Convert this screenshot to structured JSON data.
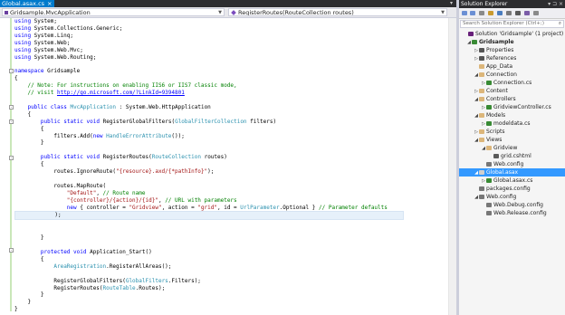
{
  "window": {
    "tab": "Global.asax.cs",
    "tab_close": "×",
    "tab_overflow": "▾"
  },
  "nav": {
    "left_scope": "Gridsample.MvcApplication",
    "right_member": "RegisterRoutes(RouteCollection routes)"
  },
  "code_lines": [
    "using System;",
    "using System.Collections.Generic;",
    "using System.Linq;",
    "using System.Web;",
    "using System.Web.Mvc;",
    "using System.Web.Routing;",
    "",
    "namespace Gridsample",
    "{",
    "    // Note: For instructions on enabling IIS6 or IIS7 classic mode,",
    "    // visit http://go.microsoft.com/?LinkId=9394801",
    "",
    "    public class MvcApplication : System.Web.HttpApplication",
    "    {",
    "        public static void RegisterGlobalFilters(GlobalFilterCollection filters)",
    "        {",
    "            filters.Add(new HandleErrorAttribute());",
    "        }",
    "",
    "        public static void RegisterRoutes(RouteCollection routes)",
    "        {",
    "            routes.IgnoreRoute(\"{resource}.axd/{*pathInfo}\");",
    "",
    "            routes.MapRoute(",
    "                \"Default\", // Route name",
    "                \"{controller}/{action}/{id}\", // URL with parameters",
    "                new { controller = \"Gridview\", action = \"grid\", id = UrlParameter.Optional } // Parameter defaults",
    "            );",
    "",
    "",
    "        }",
    "",
    "        protected void Application_Start()",
    "        {",
    "            AreaRegistration.RegisterAllAreas();",
    "",
    "            RegisterGlobalFilters(GlobalFilters.Filters);",
    "            RegisterRoutes(RouteTable.Routes);",
    "        }",
    "    }",
    "}"
  ],
  "solution_explorer": {
    "title": "Solution Explorer",
    "title_controls": "▾ ⊐ ×",
    "search_placeholder": "Search Solution Explorer (Ctrl+;)",
    "search_icon": "⌕",
    "items": [
      {
        "label": "Solution 'Gridsample' (1 project)",
        "icon": "solution-icon",
        "color": "#68217a"
      },
      {
        "label": "Gridsample",
        "icon": "csharp-project-icon",
        "color": "#388a34",
        "bold": true,
        "arrow": "◢"
      },
      {
        "label": "Properties",
        "icon": "wrench-icon",
        "color": "#555555",
        "arrow": "▷"
      },
      {
        "label": "References",
        "icon": "references-icon",
        "color": "#555555",
        "arrow": "▷"
      },
      {
        "label": "App_Data",
        "icon": "folder-icon",
        "color": "#dcb67a"
      },
      {
        "label": "Connection",
        "icon": "folder-icon",
        "color": "#dcb67a",
        "arrow": "◢"
      },
      {
        "label": "Connection.cs",
        "icon": "csharp-file-icon",
        "color": "#388a34",
        "arrow": "▷"
      },
      {
        "label": "Content",
        "icon": "folder-icon",
        "color": "#dcb67a",
        "arrow": "▷"
      },
      {
        "label": "Controllers",
        "icon": "folder-icon",
        "color": "#dcb67a",
        "arrow": "◢"
      },
      {
        "label": "GridviewController.cs",
        "icon": "csharp-file-icon",
        "color": "#388a34",
        "arrow": "▷"
      },
      {
        "label": "Models",
        "icon": "folder-icon",
        "color": "#dcb67a",
        "arrow": "◢"
      },
      {
        "label": "modeldata.cs",
        "icon": "csharp-file-icon",
        "color": "#388a34",
        "arrow": "▷"
      },
      {
        "label": "Scripts",
        "icon": "folder-icon",
        "color": "#dcb67a",
        "arrow": "▷"
      },
      {
        "label": "Views",
        "icon": "folder-icon",
        "color": "#dcb67a",
        "arrow": "◢"
      },
      {
        "label": "Gridview",
        "icon": "folder-icon",
        "color": "#dcb67a",
        "arrow": "◢"
      },
      {
        "label": "grid.cshtml",
        "icon": "razor-file-icon",
        "color": "#5a5a5a"
      },
      {
        "label": "Web.config",
        "icon": "config-file-icon",
        "color": "#777777"
      },
      {
        "label": "Global.asax",
        "icon": "asax-file-icon",
        "color": "#cfcfcf",
        "arrow": "◢",
        "selected": true
      },
      {
        "label": "Global.asax.cs",
        "icon": "csharp-file-icon",
        "color": "#388a34",
        "arrow": "▷"
      },
      {
        "label": "packages.config",
        "icon": "config-file-icon",
        "color": "#777777"
      },
      {
        "label": "Web.config",
        "icon": "config-file-icon",
        "color": "#777777",
        "arrow": "◢"
      },
      {
        "label": "Web.Debug.config",
        "icon": "config-file-icon",
        "color": "#777777"
      },
      {
        "label": "Web.Release.config",
        "icon": "config-file-icon",
        "color": "#777777"
      }
    ]
  },
  "colors": {
    "accent": "#007acc",
    "selection": "#3399ff",
    "keyword": "#0000ff",
    "type": "#2b91af",
    "comment": "#008000",
    "string": "#a31515"
  }
}
